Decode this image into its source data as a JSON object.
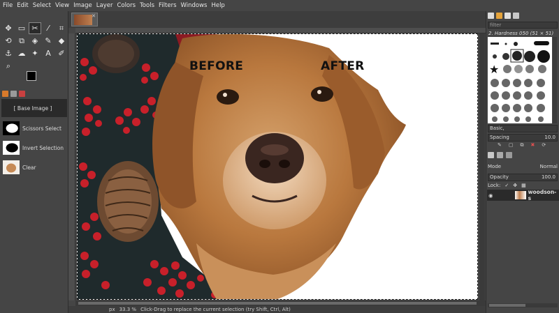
{
  "menu": [
    "File",
    "Edit",
    "Select",
    "View",
    "Image",
    "Layer",
    "Colors",
    "Tools",
    "Filters",
    "Windows",
    "Help"
  ],
  "toolbox": {
    "tools": [
      {
        "icon": "move-icon",
        "glyph": "✥"
      },
      {
        "icon": "rect-select-icon",
        "glyph": "▭"
      },
      {
        "icon": "scissors-select-icon",
        "glyph": "✂"
      },
      {
        "icon": "fuzzy-select-icon",
        "glyph": "⁄"
      },
      {
        "icon": "crop-icon",
        "glyph": "⌗"
      },
      {
        "icon": "transform-icon",
        "glyph": "⟲"
      },
      {
        "icon": "warp-icon",
        "glyph": "⧉"
      },
      {
        "icon": "cage-icon",
        "glyph": "◈"
      },
      {
        "icon": "paintbrush-icon",
        "glyph": "✎"
      },
      {
        "icon": "eraser-icon",
        "glyph": "◆"
      },
      {
        "icon": "clone-icon",
        "glyph": "⚓"
      },
      {
        "icon": "smudge-icon",
        "glyph": "☁"
      },
      {
        "icon": "dodge-icon",
        "glyph": "✦"
      },
      {
        "icon": "text-icon",
        "glyph": "A"
      },
      {
        "icon": "color-picker-icon",
        "glyph": "✐"
      },
      {
        "icon": "zoom-icon",
        "glyph": "⌕"
      }
    ]
  },
  "history": {
    "items": [
      {
        "label": "[ Base Image ]"
      },
      {
        "label": "Scissors Select"
      },
      {
        "label": "Invert Selection"
      },
      {
        "label": "Clear"
      }
    ]
  },
  "canvas": {
    "before_label": "BEFORE",
    "after_label": "AFTER"
  },
  "status": {
    "unit": "px",
    "zoom": "33.3 %",
    "message": "Click-Drag to replace the current selection (try Shift, Ctrl, Alt)"
  },
  "brushes": {
    "filter_placeholder": "filter",
    "current_brush": "2. Hardness 050 (51 × 51)",
    "preset": "Basic,",
    "spacing_label": "Spacing",
    "spacing_value": "10.0"
  },
  "layers": {
    "mode_label": "Mode",
    "mode_value": "Normal",
    "opacity_label": "Opacity",
    "opacity_value": "100.0",
    "lock_label": "Lock:",
    "layer_name": "woodson-s"
  }
}
